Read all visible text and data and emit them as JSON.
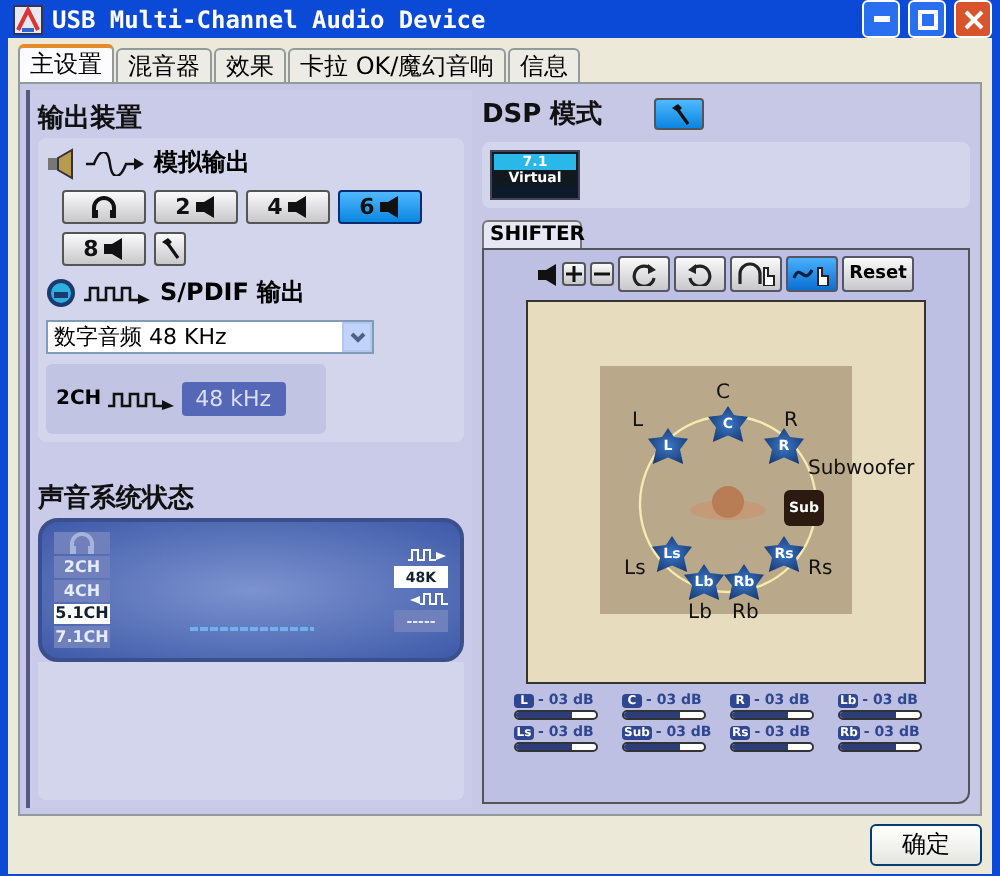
{
  "window": {
    "title": "USB Multi-Channel Audio Device"
  },
  "tabs": [
    {
      "label": "主设置",
      "selected": true
    },
    {
      "label": "混音器",
      "selected": false
    },
    {
      "label": "效果",
      "selected": false
    },
    {
      "label": "卡拉 OK/魔幻音响",
      "selected": false
    },
    {
      "label": "信息",
      "selected": false
    }
  ],
  "output": {
    "title": "输出装置",
    "analog_label": "模拟输出",
    "modes": [
      {
        "kind": "headphones",
        "selected": false
      },
      {
        "kind": "speakers",
        "label": "2",
        "selected": false
      },
      {
        "kind": "speakers",
        "label": "4",
        "selected": false
      },
      {
        "kind": "speakers",
        "label": "6",
        "selected": true
      },
      {
        "kind": "speakers",
        "label": "8",
        "selected": false
      }
    ],
    "spdif_label": "S/PDIF 输出",
    "spdif_select": "数字音频 48 KHz",
    "spdif_channels": "2CH",
    "spdif_rate": "48 kHz"
  },
  "status": {
    "title": "声音系统状态",
    "channels": [
      {
        "kind": "headphones",
        "selected": false
      },
      {
        "kind": "text",
        "label": "2CH",
        "selected": false
      },
      {
        "kind": "text",
        "label": "4CH",
        "selected": false
      },
      {
        "kind": "text",
        "label": "5.1CH",
        "selected": true
      },
      {
        "kind": "text",
        "label": "7.1CH",
        "selected": false
      }
    ],
    "out_rate": "48K",
    "in_rate": "-----"
  },
  "dsp": {
    "title": "DSP 模式",
    "mode_lines": [
      "7.1",
      "Virtual"
    ]
  },
  "shifter": {
    "tab": "SHIFTER",
    "tools": [
      {
        "kind": "rotate_cw",
        "selected": false
      },
      {
        "kind": "rotate_ccw",
        "selected": false
      },
      {
        "kind": "headphone_hand",
        "selected": false
      },
      {
        "kind": "wave_hand",
        "selected": true
      }
    ],
    "reset": "Reset",
    "speakers": [
      {
        "kind": "front",
        "badge": "L",
        "label": "L"
      },
      {
        "kind": "front",
        "badge": "C",
        "label": "C"
      },
      {
        "kind": "front",
        "badge": "R",
        "label": "R"
      },
      {
        "kind": "rear",
        "badge": "Ls",
        "label": "Ls"
      },
      {
        "kind": "rear",
        "badge": "Rs",
        "label": "Rs"
      },
      {
        "kind": "rear",
        "badge": "Lb",
        "label": "Lb"
      },
      {
        "kind": "rear",
        "badge": "Rb",
        "label": "Rb"
      },
      {
        "kind": "sub",
        "badge": "Sub",
        "label": "Subwoofer"
      }
    ],
    "meters": [
      {
        "badge": "L",
        "reading": "- 03 dB",
        "level": 0.7
      },
      {
        "badge": "C",
        "reading": "- 03 dB",
        "level": 0.7
      },
      {
        "badge": "R",
        "reading": "- 03 dB",
        "level": 0.7
      },
      {
        "badge": "Lb",
        "reading": "- 03 dB",
        "level": 0.7
      },
      {
        "badge": "Ls",
        "reading": "- 03 dB",
        "level": 0.7
      },
      {
        "badge": "Sub",
        "reading": "- 03 dB",
        "level": 0.7
      },
      {
        "badge": "Rs",
        "reading": "- 03 dB",
        "level": 0.7
      },
      {
        "badge": "Rb",
        "reading": "- 03 dB",
        "level": 0.7
      }
    ]
  },
  "ok_button": "确定"
}
